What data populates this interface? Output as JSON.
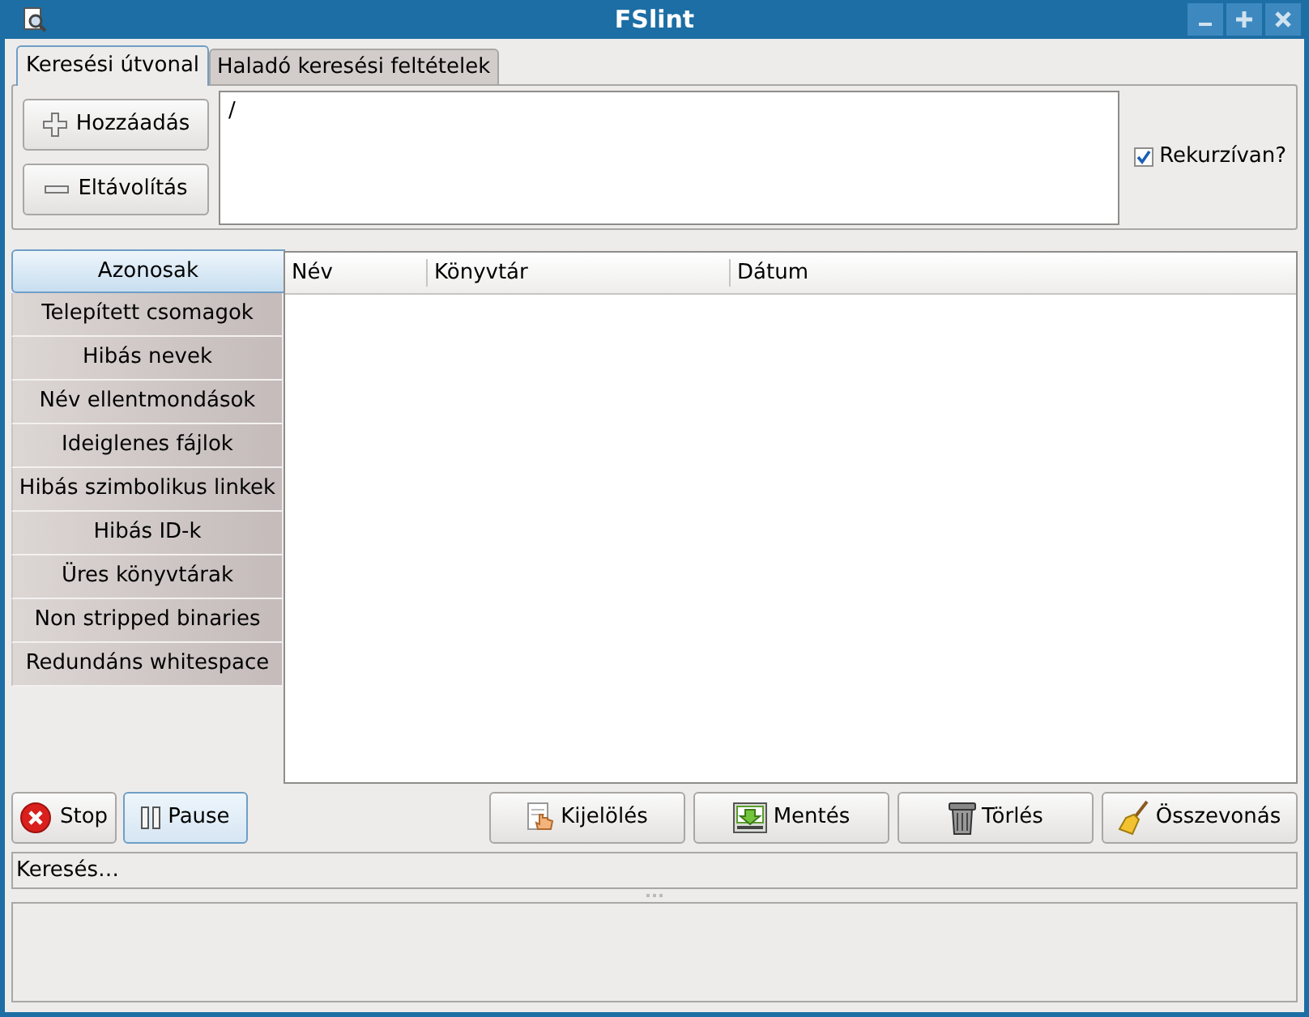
{
  "window": {
    "title": "FSlint"
  },
  "tabs": [
    {
      "label": "Keresési útvonal",
      "selected": true
    },
    {
      "label": "Haladó keresési feltételek",
      "selected": false
    }
  ],
  "path_buttons": [
    {
      "label": "Hozzáadás",
      "kind": "add"
    },
    {
      "label": "Eltávolítás",
      "kind": "remove"
    }
  ],
  "paths": [
    "/"
  ],
  "recursive": {
    "label": "Rekurzívan?",
    "checked": true
  },
  "categories": [
    {
      "label": "Azonosak",
      "selected": true
    },
    {
      "label": "Telepített csomagok",
      "selected": false
    },
    {
      "label": "Hibás nevek",
      "selected": false
    },
    {
      "label": "Név ellentmondások",
      "selected": false
    },
    {
      "label": "Ideiglenes fájlok",
      "selected": false
    },
    {
      "label": "Hibás szimbolikus linkek",
      "selected": false
    },
    {
      "label": "Hibás ID-k",
      "selected": false
    },
    {
      "label": "Üres könyvtárak",
      "selected": false
    },
    {
      "label": "Non stripped binaries",
      "selected": false
    },
    {
      "label": "Redundáns whitespace",
      "selected": false
    }
  ],
  "table": {
    "columns": [
      "Név",
      "Könyvtár",
      "Dátum"
    ]
  },
  "left_buttons": [
    {
      "label": "Stop",
      "kind": "stop",
      "focused": false
    },
    {
      "label": "Pause",
      "kind": "pause",
      "focused": true
    }
  ],
  "action_buttons": [
    {
      "label": "Kijelölés",
      "kind": "select"
    },
    {
      "label": "Mentés",
      "kind": "save"
    },
    {
      "label": "Törlés",
      "kind": "delete"
    },
    {
      "label": "Összevonás",
      "kind": "merge"
    }
  ],
  "status_bar": "Keresés…"
}
